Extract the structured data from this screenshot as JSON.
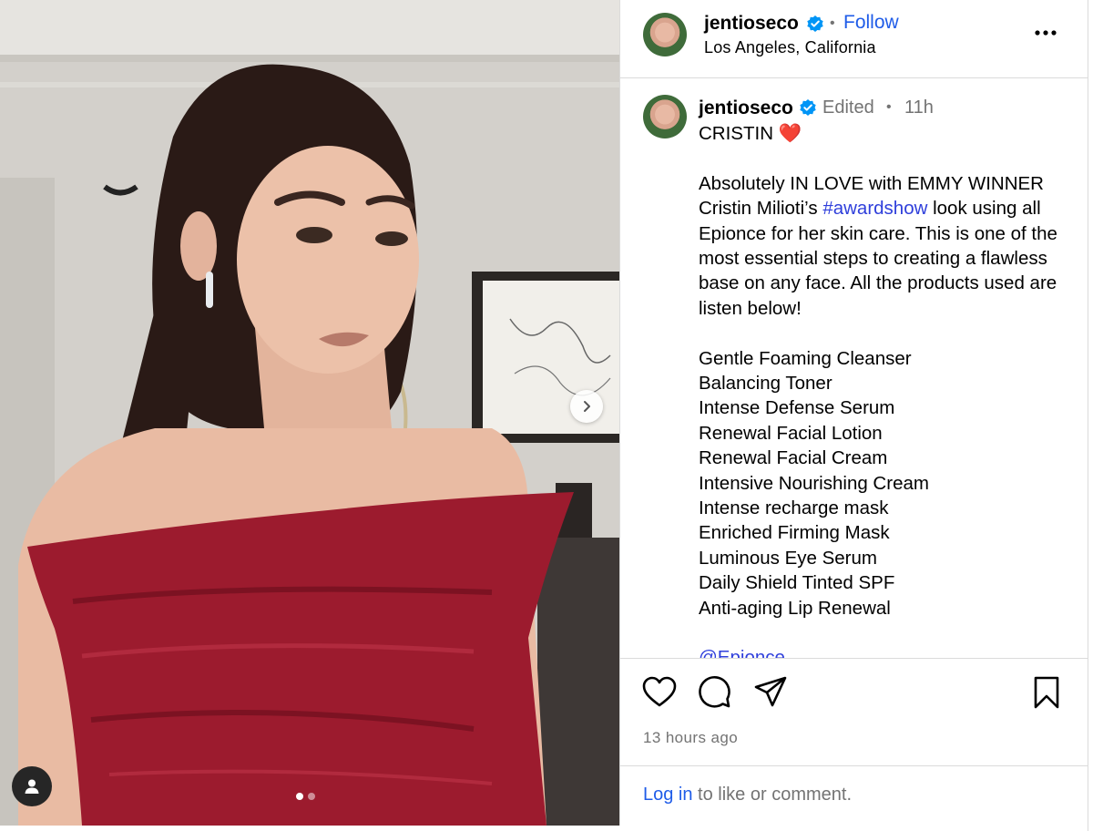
{
  "post": {
    "username": "jentioseco",
    "location": "Los Angeles, California",
    "follow_label": "Follow",
    "separator": "•",
    "edited_label": "Edited",
    "time_short": "11h",
    "caption_title": "CRISTIN",
    "caption_heart": "❤️",
    "caption_line_before_tag": "Absolutely IN LOVE with EMMY WINNER Cristin Milioti’s ",
    "hashtag": "#awardshow",
    "caption_line_after_tag": " look using all Epionce for her skin care. This is one of the most essential steps to creating a flawless base on any face. All the products used are listen below!",
    "products": [
      "Gentle Foaming Cleanser",
      "Balancing Toner",
      "Intense Defense Serum",
      "Renewal Facial Lotion",
      "Renewal Facial Cream",
      "Intensive Nourishing Cream",
      "Intense recharge mask",
      "Enriched Firming Mask",
      "Luminous Eye Serum",
      "Daily Shield Tinted SPF",
      "Anti-aging Lip Renewal"
    ],
    "mention": "@Epionce",
    "timestamp": "13 hours ago",
    "login_link": "Log in",
    "login_rest": " to like or comment."
  },
  "media": {
    "slide_count": 2,
    "active_slide": 1
  },
  "icons": {
    "verified": "verified-badge-icon",
    "more": "more-options-icon",
    "like": "heart-icon",
    "comment": "comment-icon",
    "share": "share-icon",
    "save": "bookmark-icon",
    "next": "chevron-right-icon",
    "tag": "user-tag-icon"
  },
  "colors": {
    "link_blue": "#1f5ce8",
    "verified_blue": "#0095f6",
    "secondary_text": "#737373",
    "dress_red": "#9c1b2e"
  }
}
